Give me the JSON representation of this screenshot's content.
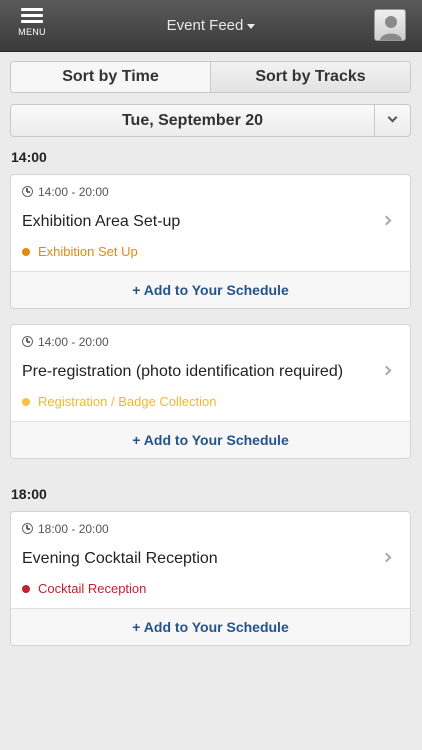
{
  "header": {
    "menu_label": "MENU",
    "title": "Event Feed"
  },
  "sort": {
    "by_time": "Sort by Time",
    "by_tracks": "Sort by Tracks"
  },
  "date_selector": {
    "label": "Tue, September 20"
  },
  "groups": [
    {
      "time": "14:00"
    },
    {
      "time": "18:00"
    }
  ],
  "events": [
    {
      "time": "14:00 - 20:00",
      "title": "Exhibition Area Set-up",
      "track": "Exhibition Set Up",
      "track_color": "#e08a12",
      "add_label": "Add to Your Schedule"
    },
    {
      "time": "14:00 - 20:00",
      "title": "Pre-registration (photo identification required)",
      "track": "Registration / Badge Collection",
      "track_color": "#f5c242",
      "add_label": "Add to Your Schedule"
    },
    {
      "time": "18:00 - 20:00",
      "title": "Evening Cocktail Reception",
      "track": "Cocktail Reception",
      "track_color": "#c0222e",
      "add_label": "Add to Your Schedule"
    }
  ],
  "icons": {
    "menu": "hamburger-icon",
    "dropdown": "caret-down-icon",
    "profile": "user-silhouette-icon",
    "clock": "clock-icon",
    "chevron": "chevron-right-icon",
    "add": "plus-icon"
  }
}
